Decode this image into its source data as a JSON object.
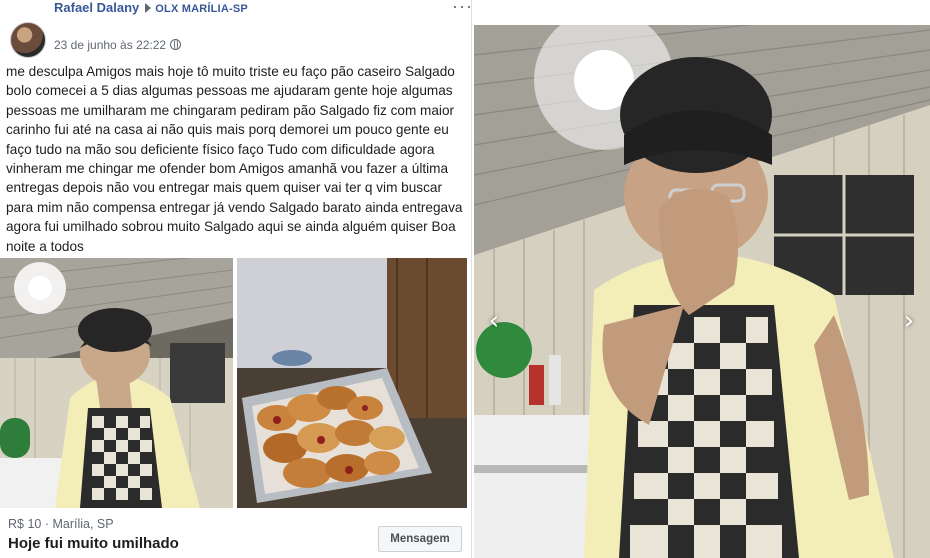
{
  "post": {
    "author": "Rafael Dalany",
    "group": "OLX MARÍLIA-SP",
    "timestamp": "23 de junho às 22:22",
    "more_icon": "more-dots-icon",
    "privacy_icon": "globe-icon",
    "text": "me desculpa Amigos mais hoje tô muito triste eu faço pão caseiro Salgado bolo comecei a 5 dias algumas pessoas me ajudaram gente hoje algumas pessoas me umilharam me chingaram pediram pão Salgado fiz com maior carinho fui até na casa ai não quis mais porq demorei um pouco gente eu faço tudo na mão sou deficiente físico faço Tudo com dificuldade agora vinheram me chingar me ofender bom Amigos amanhã vou fazer a última entregas depois não vou entregar mais quem quiser vai ter q vim buscar para mim não compensa entregar já vendo Salgado barato ainda entregava agora fui umilhado sobrou muito Salgado aqui se ainda alguém quiser Boa noite a todos"
  },
  "listing": {
    "price_location": "R$ 10 · Marília, SP",
    "title": "Hoje fui muito umilhado",
    "message_button": "Mensagem"
  },
  "viewer": {
    "prev_icon": "chevron-left-icon",
    "next_icon": "chevron-right-icon"
  },
  "colors": {
    "link": "#385898",
    "secondary_text": "#606770",
    "apron_light": "#e8e4d8",
    "apron_dark": "#2b2b2b",
    "shirt": "#f3eeb8"
  }
}
